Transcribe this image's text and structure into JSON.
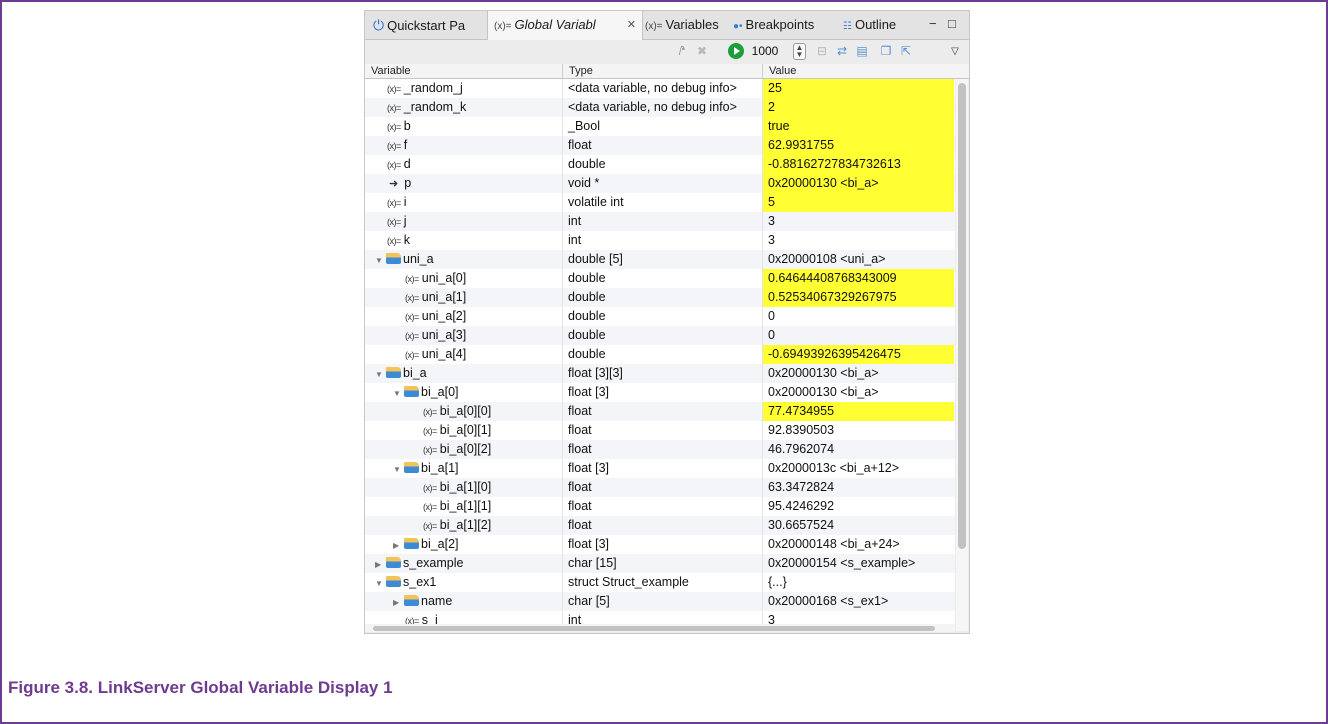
{
  "tabs": [
    {
      "label": "Quickstart Pa",
      "icon": "power-icon"
    },
    {
      "label": "Global Variabl",
      "icon": "variable-icon",
      "active": true
    },
    {
      "label": "Variables",
      "icon": "variable-icon"
    },
    {
      "label": "Breakpoints",
      "icon": "breakpoints-icon"
    },
    {
      "label": "Outline",
      "icon": "outline-icon"
    }
  ],
  "toolbar": {
    "refresh_value": "1000"
  },
  "columns": [
    "Variable",
    "Type",
    "Value"
  ],
  "rows": [
    {
      "name": "_random_j",
      "type": "<data variable, no debug info>",
      "value": "25",
      "highlight": true
    },
    {
      "name": "_random_k",
      "type": "<data variable, no debug info>",
      "value": "2",
      "highlight": true
    },
    {
      "name": "b",
      "type": "_Bool",
      "value": "true",
      "highlight": true
    },
    {
      "name": "f",
      "type": "float",
      "value": "62.9931755",
      "highlight": true
    },
    {
      "name": "d",
      "type": "double",
      "value": "-0.88162727834732613",
      "highlight": true
    },
    {
      "name": "p",
      "type": "void *",
      "value": "0x20000130 <bi_a>",
      "highlight": true
    },
    {
      "name": "i",
      "type": "volatile int",
      "value": "5",
      "highlight": true
    },
    {
      "name": "j",
      "type": "int",
      "value": "3",
      "highlight": false
    },
    {
      "name": "k",
      "type": "int",
      "value": "3",
      "highlight": false
    },
    {
      "name": "uni_a",
      "type": "double [5]",
      "value": "0x20000108 <uni_a>",
      "highlight": false
    },
    {
      "name": "uni_a[0]",
      "type": "double",
      "value": "0.64644408768343009",
      "highlight": true
    },
    {
      "name": "uni_a[1]",
      "type": "double",
      "value": "0.52534067329267975",
      "highlight": true
    },
    {
      "name": "uni_a[2]",
      "type": "double",
      "value": "0",
      "highlight": false
    },
    {
      "name": "uni_a[3]",
      "type": "double",
      "value": "0",
      "highlight": false
    },
    {
      "name": "uni_a[4]",
      "type": "double",
      "value": "-0.69493926395426475",
      "highlight": true
    },
    {
      "name": "bi_a",
      "type": "float [3][3]",
      "value": "0x20000130 <bi_a>",
      "highlight": false
    },
    {
      "name": "bi_a[0]",
      "type": "float [3]",
      "value": "0x20000130 <bi_a>",
      "highlight": false
    },
    {
      "name": "bi_a[0][0]",
      "type": "float",
      "value": "77.4734955",
      "highlight": true
    },
    {
      "name": "bi_a[0][1]",
      "type": "float",
      "value": "92.8390503",
      "highlight": false
    },
    {
      "name": "bi_a[0][2]",
      "type": "float",
      "value": "46.7962074",
      "highlight": false
    },
    {
      "name": "bi_a[1]",
      "type": "float [3]",
      "value": "0x2000013c <bi_a+12>",
      "highlight": false
    },
    {
      "name": "bi_a[1][0]",
      "type": "float",
      "value": "63.3472824",
      "highlight": false
    },
    {
      "name": "bi_a[1][1]",
      "type": "float",
      "value": "95.4246292",
      "highlight": false
    },
    {
      "name": "bi_a[1][2]",
      "type": "float",
      "value": "30.6657524",
      "highlight": false
    },
    {
      "name": "bi_a[2]",
      "type": "float [3]",
      "value": "0x20000148 <bi_a+24>",
      "highlight": false
    },
    {
      "name": "s_example",
      "type": "char [15]",
      "value": "0x20000154 <s_example>",
      "highlight": false
    },
    {
      "name": "s_ex1",
      "type": "struct Struct_example",
      "value": "{...}",
      "highlight": false
    },
    {
      "name": "name",
      "type": "char [5]",
      "value": "0x20000168 <s_ex1>",
      "highlight": false
    },
    {
      "name": "s_i",
      "type": "int",
      "value": "3",
      "highlight": false
    }
  ],
  "caption": "Figure 3.8. LinkServer Global Variable Display 1"
}
